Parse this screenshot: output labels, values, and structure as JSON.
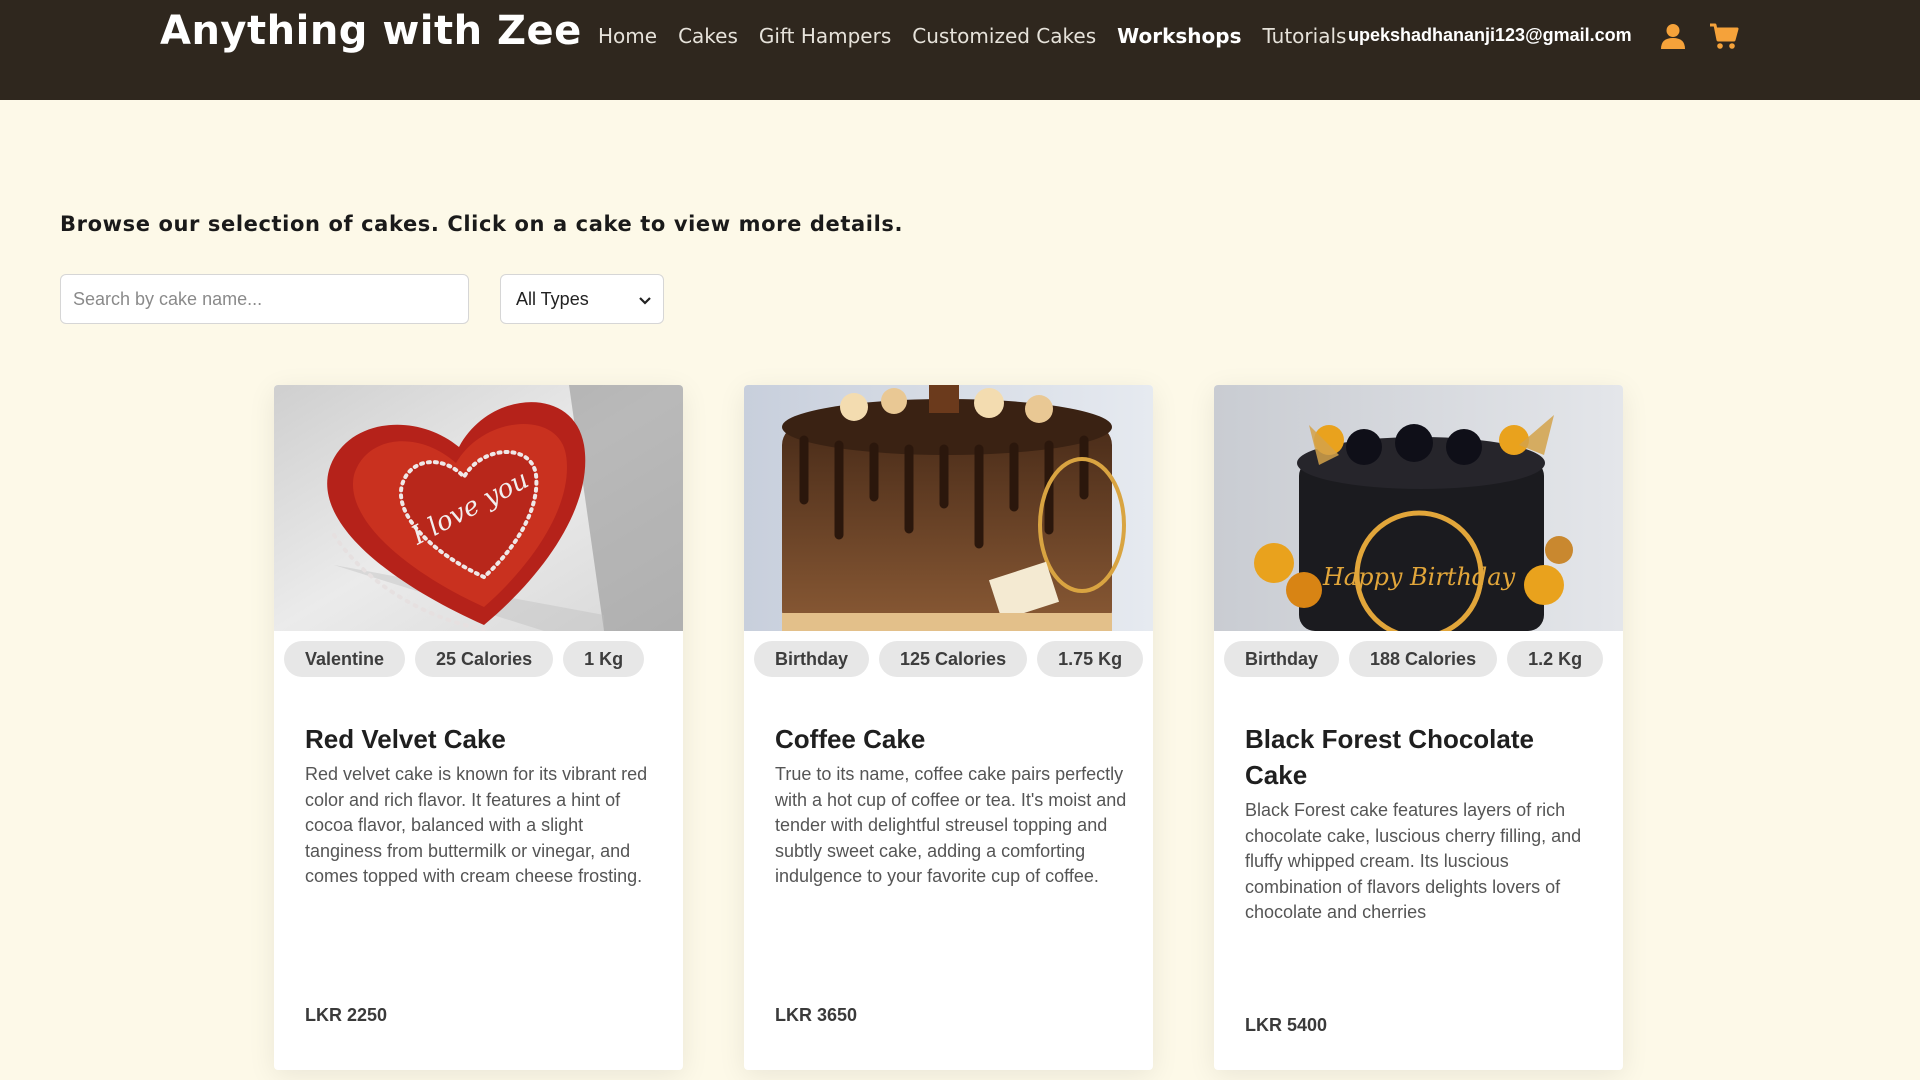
{
  "navbar": {
    "brand": "Anything with Zee",
    "links": [
      "Home",
      "Cakes",
      "Gift Hampers",
      "Customized Cakes",
      "Workshops",
      "Tutorials"
    ],
    "active_link": "Workshops",
    "email": "upekshadhananji123@gmail.com",
    "icons": [
      "user-icon",
      "cart-icon"
    ],
    "accent_color": "#f5a23a"
  },
  "intro": {
    "text": "Browse our selection of cakes. Click on a cake to view more details."
  },
  "filters": {
    "search_placeholder": "Search by cake name...",
    "type_selected": "All Types"
  },
  "cards": [
    {
      "tags": [
        "Valentine",
        "25 Calories",
        "1 Kg"
      ],
      "title": "Red Velvet Cake",
      "description": "Red velvet cake is known for its vibrant red color and rich flavor. It features a hint of cocoa flavor, balanced with a slight tanginess from buttermilk or vinegar, and comes topped with cream cheese frosting.",
      "price": "LKR 2250",
      "image_text": "I love you"
    },
    {
      "tags": [
        "Birthday",
        "125 Calories",
        "1.75 Kg"
      ],
      "title": "Coffee Cake",
      "description": "True to its name, coffee cake pairs perfectly with a hot cup of coffee or tea. It's moist and tender with delightful streusel topping and subtly sweet cake, adding a comforting indulgence to your favorite cup of coffee.",
      "price": "LKR 3650"
    },
    {
      "tags": [
        "Birthday",
        "188 Calories",
        "1.2 Kg"
      ],
      "title": "Black Forest Chocolate Cake",
      "description": "Black Forest cake features layers of rich chocolate cake, luscious cherry filling, and fluffy whipped cream. Its luscious combination of flavors delights lovers of chocolate and cherries",
      "price": "LKR 5400",
      "image_text": "Happy Birthday"
    }
  ]
}
